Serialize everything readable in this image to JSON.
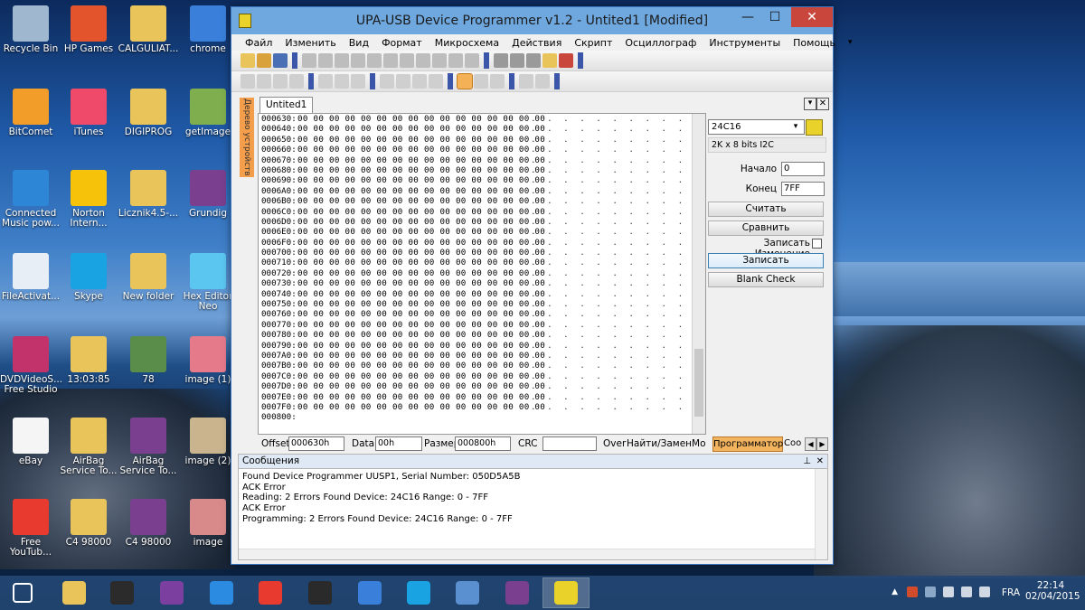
{
  "window": {
    "title": "UPA-USB Device Programmer v1.2 - Untited1 [Modified]",
    "min": "—",
    "max": "☐",
    "close": "✕"
  },
  "menu": [
    "Файл",
    "Изменить",
    "Вид",
    "Формат",
    "Микросхема",
    "Действия",
    "Скрипт",
    "Осциллограф",
    "Инструменты",
    "Помощь"
  ],
  "doc_tab": "Untited1",
  "side_tab": "Дерево устройств",
  "hex": {
    "rows": [
      "000630:",
      "000640:",
      "000650:",
      "000660:",
      "000670:",
      "000680:",
      "000690:",
      "0006A0:",
      "0006B0:",
      "0006C0:",
      "0006D0:",
      "0006E0:",
      "0006F0:",
      "000700:",
      "000710:",
      "000720:",
      "000730:",
      "000740:",
      "000750:",
      "000760:",
      "000770:",
      "000780:",
      "000790:",
      "0007A0:",
      "0007B0:",
      "0007C0:",
      "0007D0:",
      "0007E0:",
      "0007F0:",
      "000800:"
    ],
    "byte_text": "00 00 00 00 00 00 00 00 00 00 00 00 00 00 00 00",
    "ascii_text": ". . . . . . . . . . . . . . . ."
  },
  "right": {
    "chip": "24C16",
    "info": "2K x 8 bits I2C",
    "start_label": "Начало",
    "start_value": "0",
    "end_label": "Конец",
    "end_value": "7FF",
    "read": "Считать",
    "compare": "Сравнить",
    "write_changes": "Записать Изменение",
    "write": "Записать",
    "blank": "Blank Check"
  },
  "status": {
    "offset_label": "Offset",
    "offset": "000630h",
    "data_label": "Data",
    "data": "00h",
    "size_label": "Размер",
    "size": "000800h",
    "crc_label": "CRC",
    "crc": "",
    "mode": "Over",
    "find": "Найти/ЗаменМонит"
  },
  "right_tabs": [
    "Программатор",
    "Coo"
  ],
  "messages": {
    "title": "Сообщения",
    "lines": [
      "Found Device Programmer UUSP1, Serial Number: 050D5A5B",
      "ACK Error",
      "Reading:  2 Errors Found   Device: 24C16 Range: 0 - 7FF",
      "ACK Error",
      "Programming:  2 Errors Found   Device: 24C16 Range: 0 - 7FF"
    ]
  },
  "desktop_icons": [
    {
      "label": "Recycle Bin",
      "color": "#9fb7cf",
      "icon": "recycle-bin-icon"
    },
    {
      "label": "HP Games",
      "color": "#e3542c",
      "icon": "games-icon"
    },
    {
      "label": "CALGULIAT...",
      "color": "#e9c45a",
      "icon": "folder-icon"
    },
    {
      "label": "chrome",
      "color": "#3a7fd9",
      "icon": "chrome-icon"
    },
    {
      "label": "BitComet",
      "color": "#f29c2a",
      "icon": "bitcomet-icon"
    },
    {
      "label": "iTunes",
      "color": "#f04a6b",
      "icon": "itunes-icon"
    },
    {
      "label": "DIGIPROG",
      "color": "#e9c45a",
      "icon": "folder-icon"
    },
    {
      "label": "getImage",
      "color": "#7fae4f",
      "icon": "image-icon"
    },
    {
      "label": "Connected Music pow...",
      "color": "#2d86d6",
      "icon": "music-icon"
    },
    {
      "label": "Norton Intern...",
      "color": "#f6c30a",
      "icon": "norton-icon"
    },
    {
      "label": "Licznik4.5-...",
      "color": "#e9c45a",
      "icon": "folder-icon"
    },
    {
      "label": "Grundig",
      "color": "#7a3f8f",
      "icon": "archive-icon"
    },
    {
      "label": "FileActivat...",
      "color": "#e7eef6",
      "icon": "document-icon"
    },
    {
      "label": "Skype",
      "color": "#1aa3e3",
      "icon": "skype-icon"
    },
    {
      "label": "New folder",
      "color": "#e9c45a",
      "icon": "folder-icon"
    },
    {
      "label": "Hex Editor Neo",
      "color": "#5bc6f0",
      "icon": "hex-editor-icon"
    },
    {
      "label": "DVDVideoS... Free Studio",
      "color": "#c2336b",
      "icon": "dvd-studio-icon"
    },
    {
      "label": "13:03:85",
      "color": "#e9c45a",
      "icon": "folder-icon"
    },
    {
      "label": "78",
      "color": "#5a8d4a",
      "icon": "image-icon"
    },
    {
      "label": "image (1)",
      "color": "#e47a8a",
      "icon": "image-icon"
    },
    {
      "label": "eBay",
      "color": "#f5f5f5",
      "icon": "ebay-icon"
    },
    {
      "label": "AirBag Service To...",
      "color": "#e9c45a",
      "icon": "folder-icon"
    },
    {
      "label": "AirBag Service To...",
      "color": "#7a3f8f",
      "icon": "archive-icon"
    },
    {
      "label": "image (2)",
      "color": "#c9b48d",
      "icon": "image-icon"
    },
    {
      "label": "Free YouTub...",
      "color": "#e83a2f",
      "icon": "download-icon"
    },
    {
      "label": "C4 98000",
      "color": "#e9c45a",
      "icon": "folder-icon"
    },
    {
      "label": "C4 98000",
      "color": "#7a3f8f",
      "icon": "archive-icon"
    },
    {
      "label": "image",
      "color": "#d88a8a",
      "icon": "image-icon"
    }
  ],
  "taskbar": {
    "apps": [
      {
        "icon": "start-icon",
        "color": "#ffffff"
      },
      {
        "icon": "explorer-icon",
        "color": "#e9c45a"
      },
      {
        "icon": "media-icon",
        "color": "#2b2b2b"
      },
      {
        "icon": "wifi-app-icon",
        "color": "#7b3fa0"
      },
      {
        "icon": "ie-icon",
        "color": "#2a8be0"
      },
      {
        "icon": "download-icon",
        "color": "#e83a2f"
      },
      {
        "icon": "hp-icon",
        "color": "#2a2a2a"
      },
      {
        "icon": "chrome-icon",
        "color": "#3a7fd9"
      },
      {
        "icon": "skype-icon",
        "color": "#1aa3e3"
      },
      {
        "icon": "control-panel-icon",
        "color": "#5a8fd0"
      },
      {
        "icon": "archive-icon",
        "color": "#7a3f8f"
      },
      {
        "icon": "chip-programmer-icon",
        "color": "#e9d22a"
      }
    ],
    "lang": "FRA",
    "time": "22:14",
    "date": "02/04/2015"
  }
}
